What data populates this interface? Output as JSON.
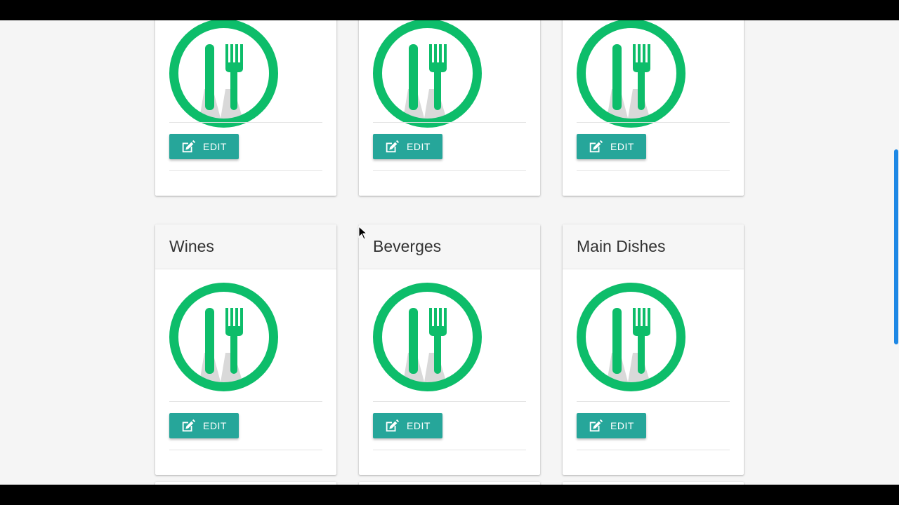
{
  "colors": {
    "brand_green": "#0dbd6a",
    "button_teal": "#26a69a",
    "background": "#f5f5f5",
    "scrollbar": "#1e88e5"
  },
  "icons": {
    "card_logo": "fork-knife-icon",
    "edit": "edit-pencil-icon"
  },
  "cards_top_row": [
    {
      "edit_label": "EDIT"
    },
    {
      "edit_label": "EDIT"
    },
    {
      "edit_label": "EDIT"
    }
  ],
  "cards_bottom_row": [
    {
      "title": "Wines",
      "edit_label": "EDIT"
    },
    {
      "title": "Beverges",
      "edit_label": "EDIT"
    },
    {
      "title": "Main Dishes",
      "edit_label": "EDIT"
    }
  ]
}
